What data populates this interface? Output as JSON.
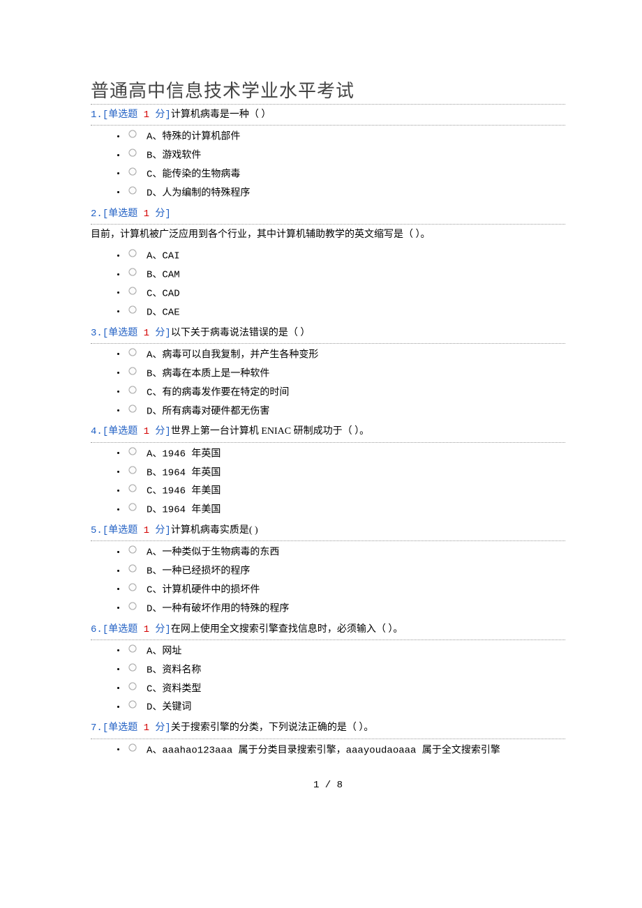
{
  "title": "普通高中信息技术学业水平考试",
  "type_label_prefix": "[",
  "type_label": "单选题 ",
  "type_label_points_suffix": " 分]",
  "points": "1",
  "footer": "1 / 8",
  "questions": [
    {
      "num": "1.",
      "stem": "计算机病毒是一种（ ）",
      "stem_inline": true,
      "options": [
        "A、特殊的计算机部件",
        "B、游戏软件",
        "C、能传染的生物病毒",
        "D、人为编制的特殊程序"
      ]
    },
    {
      "num": "2.",
      "stem": "目前，计算机被广泛应用到各个行业，其中计算机辅助教学的英文缩写是（ ）。",
      "stem_inline": false,
      "options": [
        "A、CAI",
        "B、CAM",
        "C、CAD",
        "D、CAE"
      ]
    },
    {
      "num": "3.",
      "stem": "以下关于病毒说法错误的是（ ）",
      "stem_inline": true,
      "options": [
        "A、病毒可以自我复制，并产生各种变形",
        "B、病毒在本质上是一种软件",
        "C、有的病毒发作要在特定的时间",
        "D、所有病毒对硬件都无伤害"
      ]
    },
    {
      "num": "4.",
      "stem": "世界上第一台计算机 ENIAC 研制成功于（ ）。",
      "stem_inline": true,
      "options": [
        "A、1946 年英国",
        "B、1964 年英国",
        "C、1946 年美国",
        "D、1964 年美国"
      ]
    },
    {
      "num": "5.",
      "stem": "计算机病毒实质是( )",
      "stem_inline": true,
      "options": [
        "A、一种类似于生物病毒的东西",
        "B、一种已经损坏的程序",
        "C、计算机硬件中的损坏件",
        "D、一种有破坏作用的特殊的程序"
      ]
    },
    {
      "num": "6.",
      "stem": "在网上使用全文搜索引擎查找信息时，必须输入（ ）。",
      "stem_inline": true,
      "options": [
        "A、网址",
        "B、资料名称",
        "C、资料类型",
        "D、关键词"
      ]
    },
    {
      "num": "7.",
      "stem": "关于搜索引擎的分类，下列说法正确的是（ ）。",
      "stem_inline": true,
      "options": [
        "A、aaahao123aaa 属于分类目录搜索引擎，aaayoudaoaaa 属于全文搜索引擎"
      ]
    }
  ]
}
